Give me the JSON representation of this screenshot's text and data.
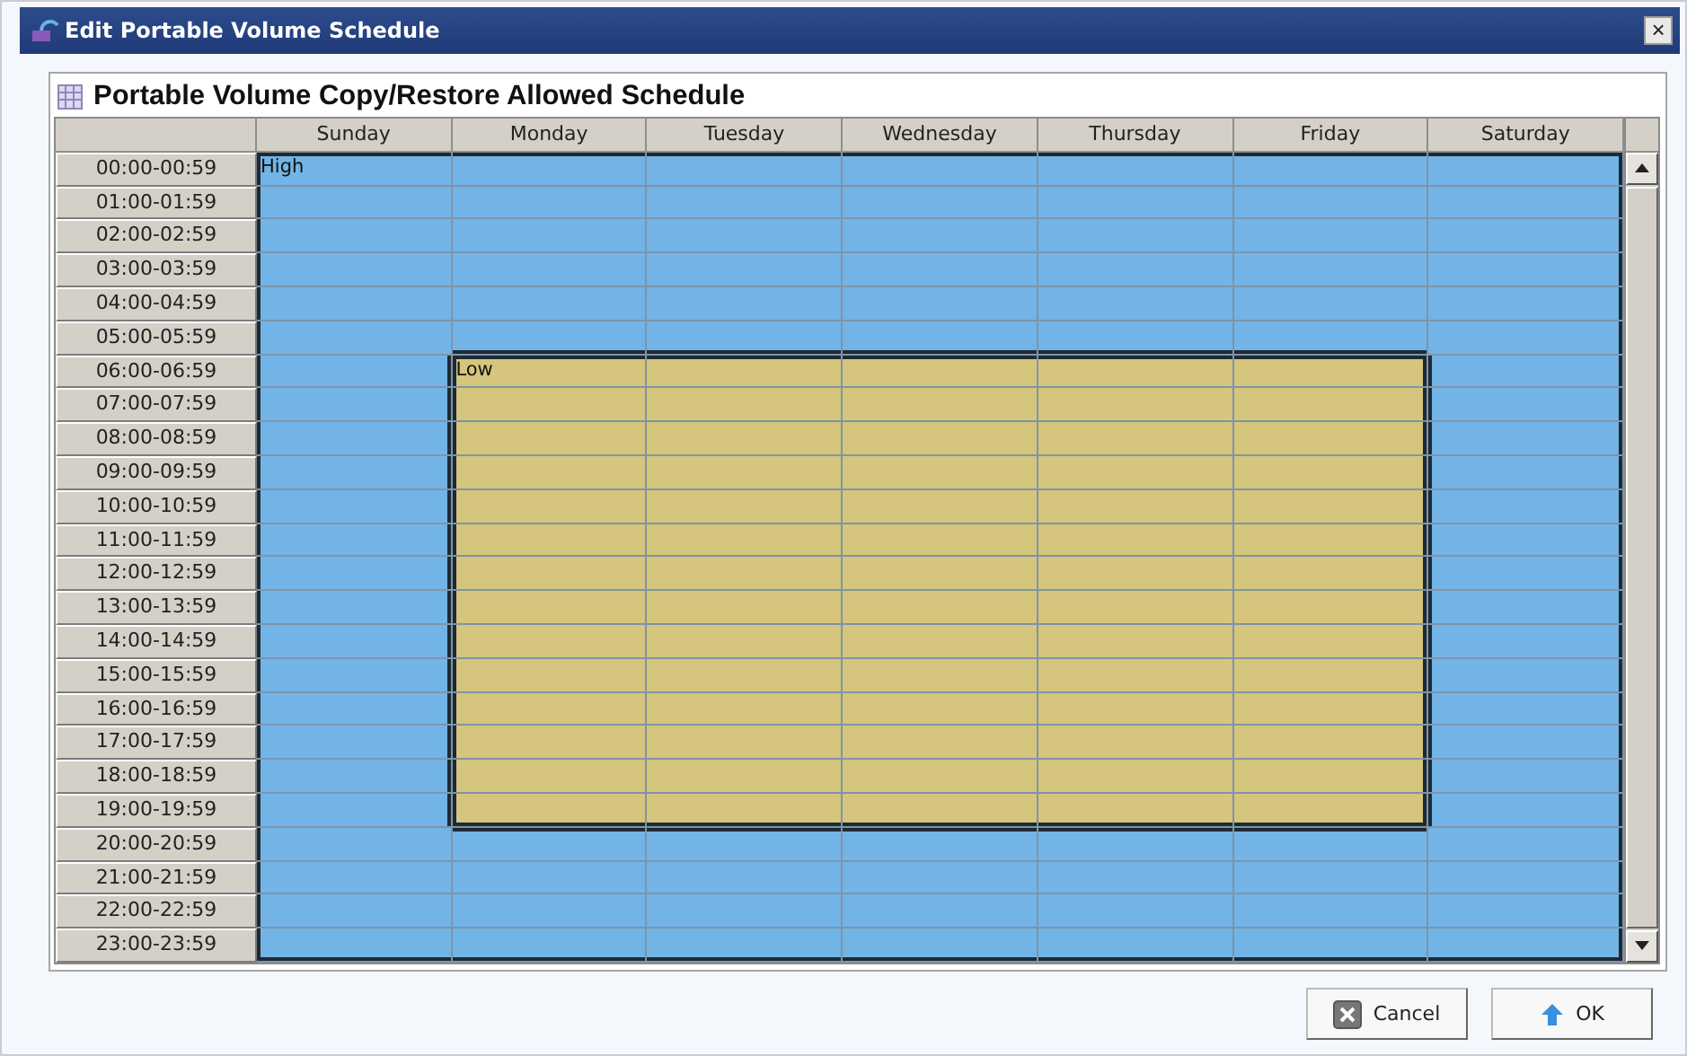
{
  "window": {
    "title": "Edit Portable Volume Schedule",
    "close": "×"
  },
  "panel": {
    "title": "Portable Volume Copy/Restore Allowed Schedule"
  },
  "days": [
    "Sunday",
    "Monday",
    "Tuesday",
    "Wednesday",
    "Thursday",
    "Friday",
    "Saturday"
  ],
  "rows": [
    {
      "time": "00:00-00:59",
      "cells": [
        {
          "kind": "high",
          "label": "High"
        },
        {
          "kind": "high"
        },
        {
          "kind": "high"
        },
        {
          "kind": "high"
        },
        {
          "kind": "high"
        },
        {
          "kind": "high"
        },
        {
          "kind": "high"
        }
      ]
    },
    {
      "time": "01:00-01:59",
      "cells": [
        {
          "kind": "high"
        },
        {
          "kind": "high"
        },
        {
          "kind": "high"
        },
        {
          "kind": "high"
        },
        {
          "kind": "high"
        },
        {
          "kind": "high"
        },
        {
          "kind": "high"
        }
      ]
    },
    {
      "time": "02:00-02:59",
      "cells": [
        {
          "kind": "high"
        },
        {
          "kind": "high"
        },
        {
          "kind": "high"
        },
        {
          "kind": "high"
        },
        {
          "kind": "high"
        },
        {
          "kind": "high"
        },
        {
          "kind": "high"
        }
      ]
    },
    {
      "time": "03:00-03:59",
      "cells": [
        {
          "kind": "high"
        },
        {
          "kind": "high"
        },
        {
          "kind": "high"
        },
        {
          "kind": "high"
        },
        {
          "kind": "high"
        },
        {
          "kind": "high"
        },
        {
          "kind": "high"
        }
      ]
    },
    {
      "time": "04:00-04:59",
      "cells": [
        {
          "kind": "high"
        },
        {
          "kind": "high"
        },
        {
          "kind": "high"
        },
        {
          "kind": "high"
        },
        {
          "kind": "high"
        },
        {
          "kind": "high"
        },
        {
          "kind": "high"
        }
      ]
    },
    {
      "time": "05:00-05:59",
      "cells": [
        {
          "kind": "high"
        },
        {
          "kind": "high"
        },
        {
          "kind": "high"
        },
        {
          "kind": "high"
        },
        {
          "kind": "high"
        },
        {
          "kind": "high"
        },
        {
          "kind": "high"
        }
      ]
    },
    {
      "time": "06:00-06:59",
      "cells": [
        {
          "kind": "high"
        },
        {
          "kind": "low",
          "label": "Low"
        },
        {
          "kind": "low"
        },
        {
          "kind": "low"
        },
        {
          "kind": "low"
        },
        {
          "kind": "low"
        },
        {
          "kind": "high"
        }
      ]
    },
    {
      "time": "07:00-07:59",
      "cells": [
        {
          "kind": "high"
        },
        {
          "kind": "low"
        },
        {
          "kind": "low"
        },
        {
          "kind": "low"
        },
        {
          "kind": "low"
        },
        {
          "kind": "low"
        },
        {
          "kind": "high"
        }
      ]
    },
    {
      "time": "08:00-08:59",
      "cells": [
        {
          "kind": "high"
        },
        {
          "kind": "low"
        },
        {
          "kind": "low"
        },
        {
          "kind": "low"
        },
        {
          "kind": "low"
        },
        {
          "kind": "low"
        },
        {
          "kind": "high"
        }
      ]
    },
    {
      "time": "09:00-09:59",
      "cells": [
        {
          "kind": "high"
        },
        {
          "kind": "low"
        },
        {
          "kind": "low"
        },
        {
          "kind": "low"
        },
        {
          "kind": "low"
        },
        {
          "kind": "low"
        },
        {
          "kind": "high"
        }
      ]
    },
    {
      "time": "10:00-10:59",
      "cells": [
        {
          "kind": "high"
        },
        {
          "kind": "low"
        },
        {
          "kind": "low"
        },
        {
          "kind": "low"
        },
        {
          "kind": "low"
        },
        {
          "kind": "low"
        },
        {
          "kind": "high"
        }
      ]
    },
    {
      "time": "11:00-11:59",
      "cells": [
        {
          "kind": "high"
        },
        {
          "kind": "low"
        },
        {
          "kind": "low"
        },
        {
          "kind": "low"
        },
        {
          "kind": "low"
        },
        {
          "kind": "low"
        },
        {
          "kind": "high"
        }
      ]
    },
    {
      "time": "12:00-12:59",
      "cells": [
        {
          "kind": "high"
        },
        {
          "kind": "low"
        },
        {
          "kind": "low"
        },
        {
          "kind": "low"
        },
        {
          "kind": "low"
        },
        {
          "kind": "low"
        },
        {
          "kind": "high"
        }
      ]
    },
    {
      "time": "13:00-13:59",
      "cells": [
        {
          "kind": "high"
        },
        {
          "kind": "low"
        },
        {
          "kind": "low"
        },
        {
          "kind": "low"
        },
        {
          "kind": "low"
        },
        {
          "kind": "low"
        },
        {
          "kind": "high"
        }
      ]
    },
    {
      "time": "14:00-14:59",
      "cells": [
        {
          "kind": "high"
        },
        {
          "kind": "low"
        },
        {
          "kind": "low"
        },
        {
          "kind": "low"
        },
        {
          "kind": "low"
        },
        {
          "kind": "low"
        },
        {
          "kind": "high"
        }
      ]
    },
    {
      "time": "15:00-15:59",
      "cells": [
        {
          "kind": "high"
        },
        {
          "kind": "low"
        },
        {
          "kind": "low"
        },
        {
          "kind": "low"
        },
        {
          "kind": "low"
        },
        {
          "kind": "low"
        },
        {
          "kind": "high"
        }
      ]
    },
    {
      "time": "16:00-16:59",
      "cells": [
        {
          "kind": "high"
        },
        {
          "kind": "low"
        },
        {
          "kind": "low"
        },
        {
          "kind": "low"
        },
        {
          "kind": "low"
        },
        {
          "kind": "low"
        },
        {
          "kind": "high"
        }
      ]
    },
    {
      "time": "17:00-17:59",
      "cells": [
        {
          "kind": "high"
        },
        {
          "kind": "low"
        },
        {
          "kind": "low"
        },
        {
          "kind": "low"
        },
        {
          "kind": "low"
        },
        {
          "kind": "low"
        },
        {
          "kind": "high"
        }
      ]
    },
    {
      "time": "18:00-18:59",
      "cells": [
        {
          "kind": "high"
        },
        {
          "kind": "low"
        },
        {
          "kind": "low"
        },
        {
          "kind": "low"
        },
        {
          "kind": "low"
        },
        {
          "kind": "low"
        },
        {
          "kind": "high"
        }
      ]
    },
    {
      "time": "19:00-19:59",
      "cells": [
        {
          "kind": "high"
        },
        {
          "kind": "low"
        },
        {
          "kind": "low"
        },
        {
          "kind": "low"
        },
        {
          "kind": "low"
        },
        {
          "kind": "low"
        },
        {
          "kind": "high"
        }
      ]
    },
    {
      "time": "20:00-20:59",
      "cells": [
        {
          "kind": "high"
        },
        {
          "kind": "high"
        },
        {
          "kind": "high"
        },
        {
          "kind": "high"
        },
        {
          "kind": "high"
        },
        {
          "kind": "high"
        },
        {
          "kind": "high"
        }
      ]
    },
    {
      "time": "21:00-21:59",
      "cells": [
        {
          "kind": "high"
        },
        {
          "kind": "high"
        },
        {
          "kind": "high"
        },
        {
          "kind": "high"
        },
        {
          "kind": "high"
        },
        {
          "kind": "high"
        },
        {
          "kind": "high"
        }
      ]
    },
    {
      "time": "22:00-22:59",
      "cells": [
        {
          "kind": "high"
        },
        {
          "kind": "high"
        },
        {
          "kind": "high"
        },
        {
          "kind": "high"
        },
        {
          "kind": "high"
        },
        {
          "kind": "high"
        },
        {
          "kind": "high"
        }
      ]
    },
    {
      "time": "23:00-23:59",
      "cells": [
        {
          "kind": "high"
        },
        {
          "kind": "high"
        },
        {
          "kind": "high"
        },
        {
          "kind": "high"
        },
        {
          "kind": "high"
        },
        {
          "kind": "high"
        },
        {
          "kind": "high"
        }
      ]
    }
  ],
  "buttons": [
    {
      "kind": "cancel",
      "label": "Cancel"
    },
    {
      "kind": "ok",
      "label": "OK"
    }
  ]
}
